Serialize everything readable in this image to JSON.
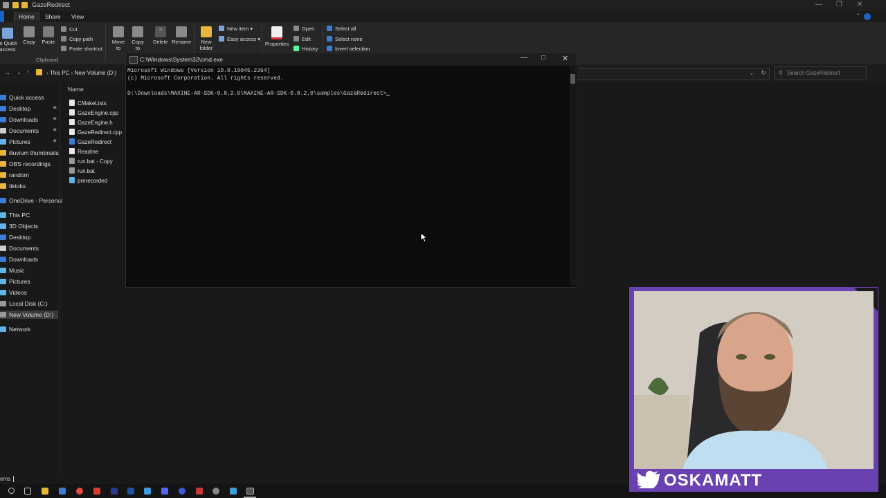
{
  "explorer": {
    "title": "GazeRedirect",
    "tabs": [
      "Home",
      "Share",
      "View"
    ],
    "ribbon": {
      "pin_label": "to Quick\naccess",
      "copy": "Copy",
      "paste": "Paste",
      "cut": "Cut",
      "copy_path": "Copy path",
      "paste_shortcut": "Paste shortcut",
      "move_to": "Move\nto",
      "copy_to": "Copy\nto",
      "delete": "Delete",
      "rename": "Rename",
      "new_folder": "New\nfolder",
      "new_item": "New item",
      "easy_access": "Easy access",
      "properties": "Properties",
      "open": "Open",
      "edit": "Edit",
      "history": "History",
      "select_all": "Select all",
      "select_none": "Select none",
      "invert_selection": "Invert selection",
      "clipboard_group": "Clipboard"
    },
    "address": {
      "this_pc": "This PC",
      "volume": "New Volume (D:)"
    },
    "search_placeholder": "Search GazeRedirect",
    "nav": {
      "quick_access": "Quick access",
      "items": [
        "Desktop",
        "Downloads",
        "Documents",
        "Pictures",
        "illuvium thumbnails",
        "OBS recordings",
        "random",
        "tiktoks"
      ],
      "onedrive": "OneDrive - Personal",
      "this_pc": "This PC",
      "pc_items": [
        "3D Objects",
        "Desktop",
        "Documents",
        "Downloads",
        "Music",
        "Pictures",
        "Videos",
        "Local Disk (C:)",
        "New Volume (D:)"
      ],
      "network": "Network"
    },
    "column_name": "Name",
    "files": [
      "CMakeLists",
      "GazeEngine.cpp",
      "GazeEngine.h",
      "GazeRedirect.cpp",
      "GazeRedirect",
      "Readme",
      "run.bat - Copy",
      "run.bat",
      "prerecorded"
    ],
    "status": "ems"
  },
  "cmd": {
    "title": "C:\\Windows\\System32\\cmd.exe",
    "lines": [
      "Microsoft Windows [Version 10.0.19045.2364]",
      "(c) Microsoft Corporation. All rights reserved.",
      "",
      "D:\\Downloads\\MAXINE-AR-SDK-0.8.2.0\\MAXINE-AR-SDK-0.8.2.0\\samples\\GazeRedirect>"
    ]
  },
  "webcam": {
    "name": "OSKAMATT"
  },
  "colors": {
    "accent_purple": "#6a41b0",
    "folder_yellow": "#e8b73a",
    "twitter_blue": "#1d9bf0"
  }
}
